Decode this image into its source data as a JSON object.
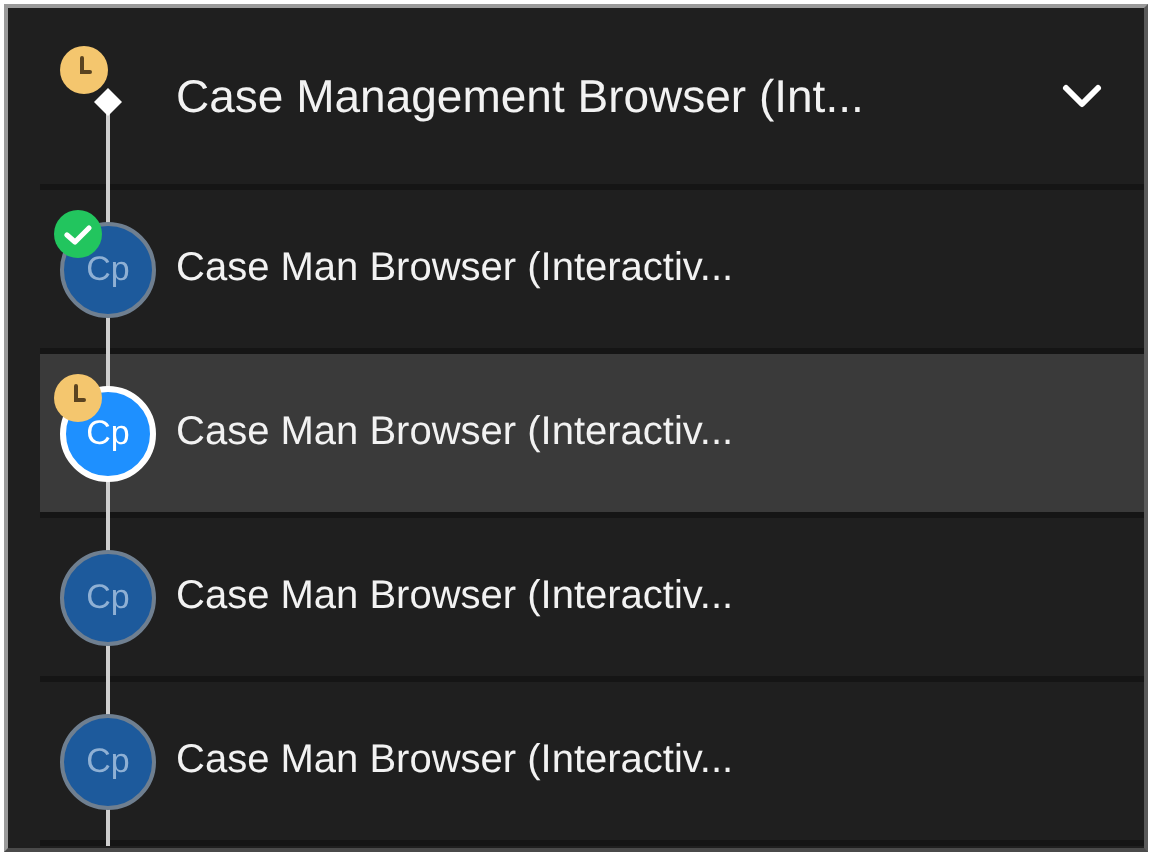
{
  "header": {
    "title": "Case Management Browser (Int...",
    "pending": true,
    "expanded": true
  },
  "steps": [
    {
      "label": "Case Man Browser (Interactiv...",
      "avatar": "Cp",
      "done": true,
      "pending": false,
      "selected": false
    },
    {
      "label": "Case Man Browser (Interactiv...",
      "avatar": "Cp",
      "done": false,
      "pending": true,
      "selected": true
    },
    {
      "label": "Case Man Browser (Interactiv...",
      "avatar": "Cp",
      "done": false,
      "pending": false,
      "selected": false
    },
    {
      "label": "Case Man Browser (Interactiv...",
      "avatar": "Cp",
      "done": false,
      "pending": false,
      "selected": false
    }
  ]
}
